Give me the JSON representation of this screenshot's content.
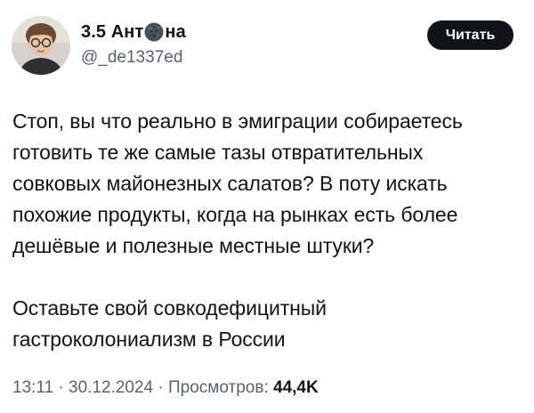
{
  "author": {
    "name_before": "3.5 Ант",
    "name_emoji": "new-moon-face-emoji",
    "name_after": "на",
    "handle": "@_de1337ed"
  },
  "follow_button": {
    "label": "Читать"
  },
  "tweet": {
    "paragraph_1": "Стоп, вы что реально в эмиграции собираетесь\nготовить те же самые тазы отвратительных\nсовковых майонезных салатов? В поту искать\nпохожие продукты, когда на рынках есть более\nдешёвые и полезные местные штуки?",
    "paragraph_2": "Оставьте свой совкодефицитный\nгастроколониализм в России"
  },
  "meta": {
    "time": "13:11",
    "separator": " · ",
    "date": "30.12.2024",
    "views_label": "Просмотров:",
    "views_count": "44,4K"
  },
  "colors": {
    "text_primary": "#0f1419",
    "text_secondary": "#536471",
    "button_bg": "#0f1419",
    "button_text": "#ffffff"
  }
}
